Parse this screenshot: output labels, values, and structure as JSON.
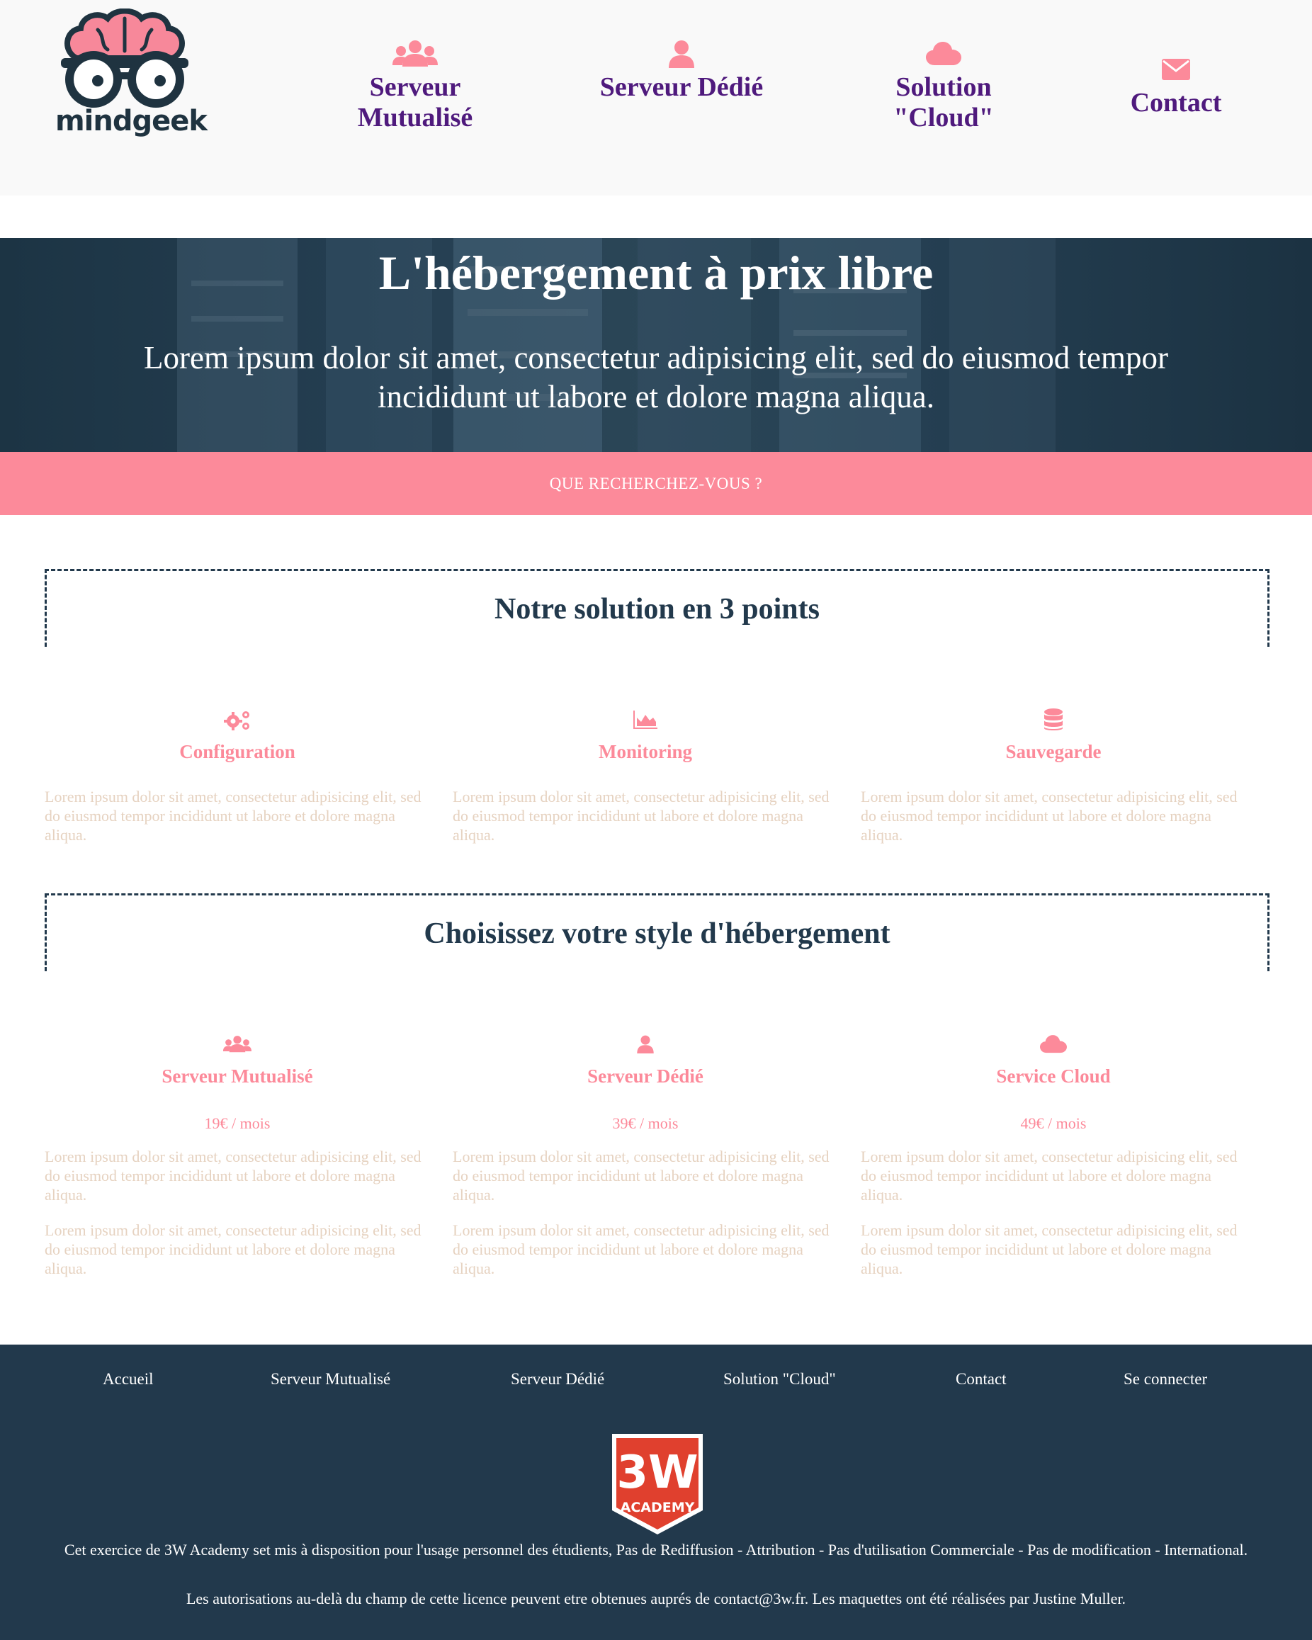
{
  "brand": {
    "logo_text": "mindgeek",
    "accent_color": "#fc8a9a",
    "nav_color": "#4f1a7d",
    "dark_color": "#22394c"
  },
  "nav": {
    "items": [
      {
        "label": "Serveur Mutualisé",
        "icon": "users-icon"
      },
      {
        "label": "Serveur Dédié",
        "icon": "user-icon"
      },
      {
        "label": "Solution \"Cloud\"",
        "icon": "cloud-icon"
      },
      {
        "label": "Contact",
        "icon": "envelope-icon"
      }
    ]
  },
  "hero": {
    "title": "L'hébergement à prix libre",
    "subtitle": "Lorem ipsum dolor sit amet, consectetur adipisicing elit, sed do eiusmod tempor incididunt ut labore et dolore magna aliqua.",
    "cta": "QUE RECHERCHEZ-VOUS ?"
  },
  "solution": {
    "title": "Notre solution en 3 points",
    "items": [
      {
        "title": "Configuration",
        "icon": "gears-icon",
        "text": "Lorem ipsum dolor sit amet, consectetur adipisicing elit, sed do eiusmod tempor incididunt ut labore et dolore magna aliqua."
      },
      {
        "title": "Monitoring",
        "icon": "area-chart-icon",
        "text": "Lorem ipsum dolor sit amet, consectetur adipisicing elit, sed do eiusmod tempor incididunt ut labore et dolore magna aliqua."
      },
      {
        "title": "Sauvegarde",
        "icon": "database-icon",
        "text": "Lorem ipsum dolor sit amet, consectetur adipisicing elit, sed do eiusmod tempor incididunt ut labore et dolore magna aliqua."
      }
    ]
  },
  "hosting": {
    "title": "Choisissez votre style d'hébergement",
    "plans": [
      {
        "title": "Serveur Mutualisé",
        "icon": "users-icon",
        "price": "19€ / mois",
        "text1": "Lorem ipsum dolor sit amet, consectetur adipisicing elit, sed do eiusmod tempor incididunt ut labore et dolore magna aliqua.",
        "text2": "Lorem ipsum dolor sit amet, consectetur adipisicing elit, sed do eiusmod tempor incididunt ut labore et dolore magna aliqua."
      },
      {
        "title": "Serveur Dédié",
        "icon": "user-icon",
        "price": "39€ / mois",
        "text1": "Lorem ipsum dolor sit amet, consectetur adipisicing elit, sed do eiusmod tempor incididunt ut labore et dolore magna aliqua.",
        "text2": "Lorem ipsum dolor sit amet, consectetur adipisicing elit, sed do eiusmod tempor incididunt ut labore et dolore magna aliqua."
      },
      {
        "title": "Service Cloud",
        "icon": "cloud-icon",
        "price": "49€ / mois",
        "text1": "Lorem ipsum dolor sit amet, consectetur adipisicing elit, sed do eiusmod tempor incididunt ut labore et dolore magna aliqua.",
        "text2": "Lorem ipsum dolor sit amet, consectetur adipisicing elit, sed do eiusmod tempor incididunt ut labore et dolore magna aliqua."
      }
    ]
  },
  "footer": {
    "links": [
      "Accueil",
      "Serveur Mutualisé",
      "Serveur Dédié",
      "Solution \"Cloud\"",
      "Contact",
      "Se connecter"
    ],
    "badge_top": "3W",
    "badge_bottom": "ACADEMY",
    "license": "Cet exercice de 3W Academy set mis à disposition pour l'usage personnel des étudients, Pas de Rediffusion - Attribution - Pas d'utilisation Commerciale - Pas de modification - International.",
    "permissions": "Les autorisations au-delà du champ de cette licence peuvent etre obtenues auprés de contact@3w.fr. Les maquettes ont été réalisées par Justine Muller."
  }
}
